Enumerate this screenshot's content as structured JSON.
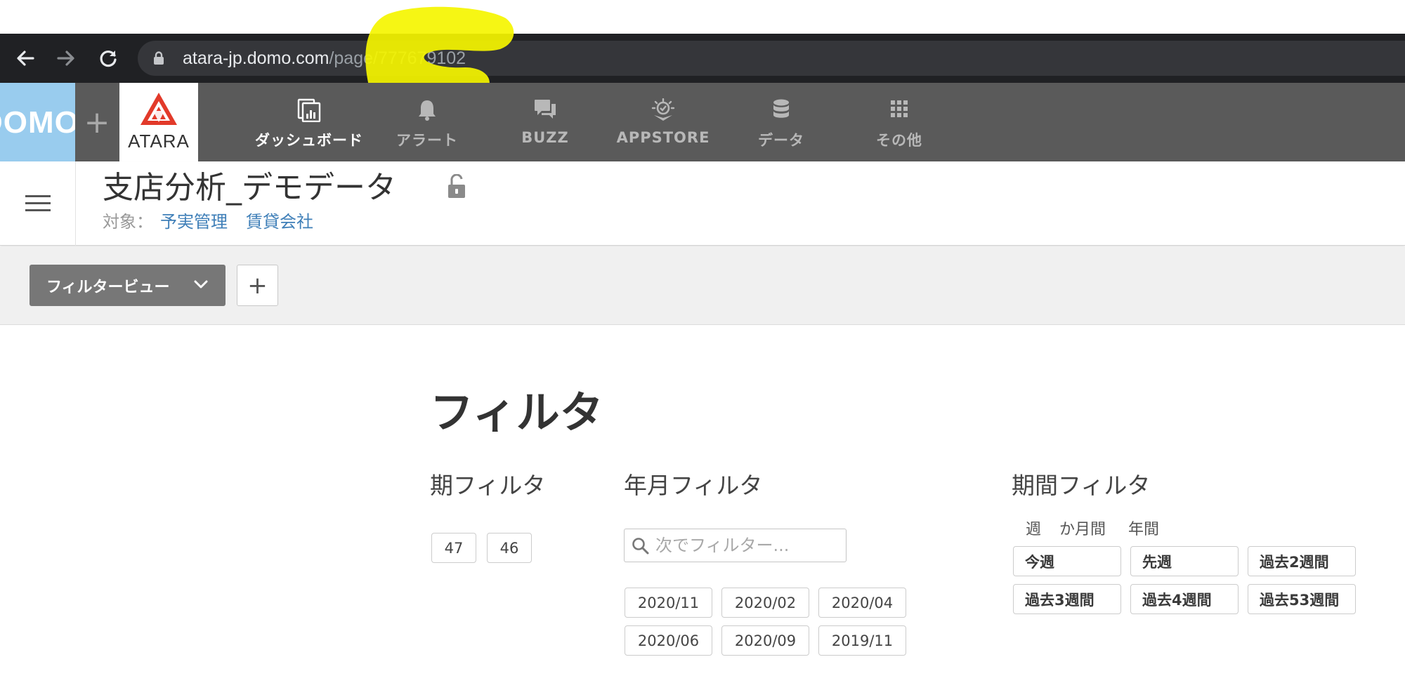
{
  "browser": {
    "url_host": "atara-jp.domo.com",
    "url_path": "/page/777679102"
  },
  "header": {
    "domo_logo": "DOMO",
    "plus_label": "+",
    "atara_logo": "ATARA",
    "nav": [
      {
        "label": "ダッシュボード",
        "icon": "dashboard-icon"
      },
      {
        "label": "アラート",
        "icon": "bell-icon"
      },
      {
        "label": "BUZZ",
        "icon": "chat-icon"
      },
      {
        "label": "APPSTORE",
        "icon": "appstore-icon"
      },
      {
        "label": "データ",
        "icon": "database-icon"
      },
      {
        "label": "その他",
        "icon": "grid-icon"
      }
    ]
  },
  "page": {
    "title": "支店分析_デモデータ",
    "target_label": "対象：",
    "links": [
      "予実管理",
      "賃貸会社"
    ]
  },
  "filter_bar": {
    "view_button": "フィルタービュー",
    "add_label": "+"
  },
  "filters": {
    "heading": "フィルタ",
    "period": {
      "title": "期フィルタ",
      "options": [
        "47",
        "46"
      ]
    },
    "yearmonth": {
      "title": "年月フィルタ",
      "search_placeholder": "次でフィルター...",
      "options": [
        "2020/11",
        "2020/02",
        "2020/04",
        "2020/06",
        "2020/09",
        "2019/11"
      ]
    },
    "range": {
      "title": "期間フィルタ",
      "tabs": [
        "週",
        "か月間",
        "年間"
      ],
      "options": [
        "今週",
        "先週",
        "過去2週間",
        "過去3週間",
        "過去4週間",
        "過去53週間"
      ]
    }
  },
  "colors": {
    "browser_bar": "#202124",
    "app_header": "#5a5a5a",
    "domo_blue": "#99ccee",
    "atara_red": "#e23a2a",
    "link_blue": "#3f7fb8",
    "highlight_yellow": "#f5f500"
  }
}
